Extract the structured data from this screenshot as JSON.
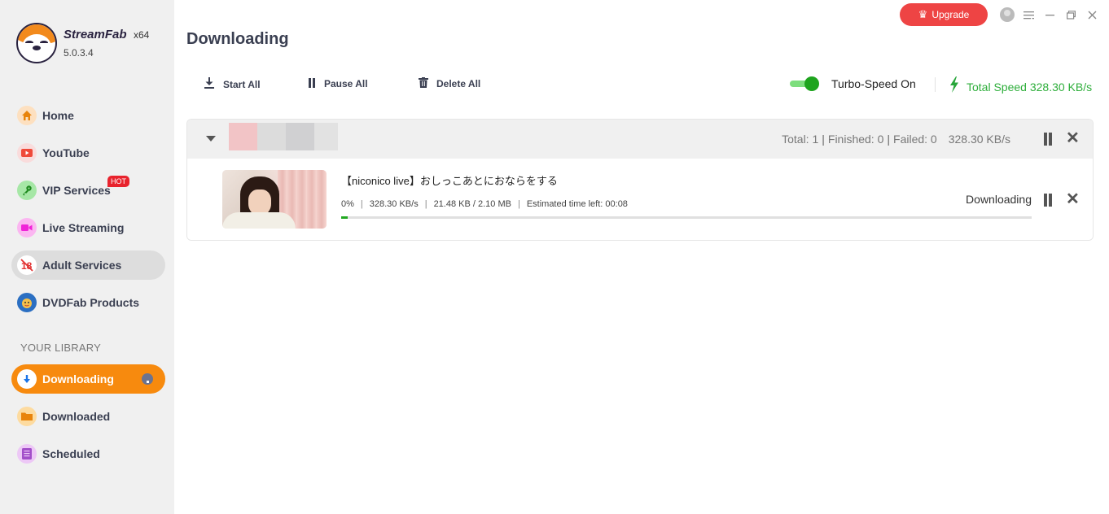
{
  "app": {
    "name": "StreamFab",
    "arch": "x64",
    "version": "5.0.3.4"
  },
  "titlebar": {
    "upgrade_label": "Upgrade",
    "icons": [
      "theme-icon",
      "menu-icon",
      "minimize-icon",
      "maximize-icon",
      "close-icon"
    ]
  },
  "sidebar": {
    "items": [
      {
        "label": "Home",
        "icon": "home-icon",
        "icon_color": "#e8840c",
        "icon_bg": "#fde0c0"
      },
      {
        "label": "YouTube",
        "icon": "youtube-icon",
        "icon_color": "#ef4a3a",
        "icon_bg": "#f9dcdc"
      },
      {
        "label": "VIP Services",
        "icon": "key-icon",
        "icon_color": "#1f8a1f",
        "icon_bg": "#a6e7a6",
        "badge": "HOT"
      },
      {
        "label": "Live Streaming",
        "icon": "video-camera-icon",
        "icon_color": "#f024d8",
        "icon_bg": "#fbb6f1"
      },
      {
        "label": "Adult Services",
        "icon": "no-18-icon",
        "icon_color": "#e23333",
        "icon_bg": "#ffffff",
        "selected": true
      },
      {
        "label": "DVDFab Products",
        "icon": "dvdfab-icon",
        "icon_color": "#2b6fc2",
        "icon_bg": "#f6c14a"
      }
    ],
    "library_header": "YOUR LIBRARY",
    "library_items": [
      {
        "label": "Downloading",
        "icon": "download-icon",
        "icon_color": "#1a74e8",
        "icon_bg": "#ffffff",
        "active": true
      },
      {
        "label": "Downloaded",
        "icon": "folder-icon",
        "icon_color": "#e8840c",
        "icon_bg": "#fddba0"
      },
      {
        "label": "Scheduled",
        "icon": "list-icon",
        "icon_color": "#a24ec9",
        "icon_bg": "#edc8f6"
      }
    ]
  },
  "main": {
    "title": "Downloading",
    "toolbar": {
      "start_all": "Start All",
      "pause_all": "Pause All",
      "delete_all": "Delete All"
    },
    "turbo": {
      "label": "Turbo-Speed On",
      "enabled": true
    },
    "total_speed": "Total Speed 328.30 KB/s",
    "colors": {
      "accent_orange": "#f78a0e",
      "speed_green": "#2eae3b",
      "upgrade_red": "#ee4444"
    },
    "group": {
      "total": "Total: 1",
      "finished": "Finished: 0",
      "failed": "Failed: 0",
      "speed": "328.30 KB/s",
      "items": [
        {
          "title": "【niconico live】おしっこあとにおならをする",
          "percent": "0%",
          "progress_fraction": 0.01,
          "speed": "328.30 KB/s",
          "size": "21.48 KB / 2.10 MB",
          "eta": "Estimated time left: 00:08",
          "status": "Downloading"
        }
      ]
    }
  }
}
